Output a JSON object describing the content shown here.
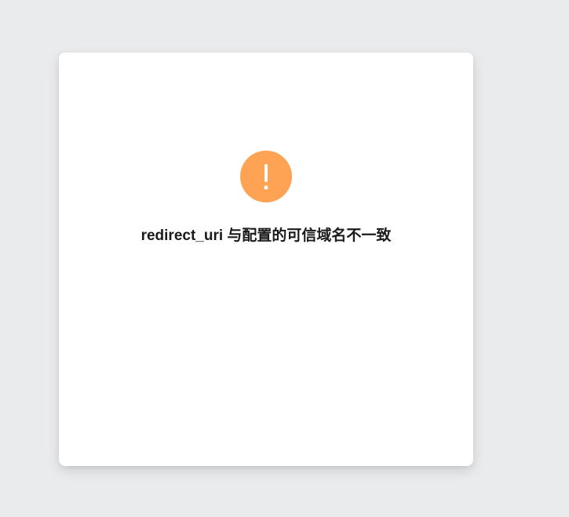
{
  "dialog": {
    "icon": "exclamation-circle-icon",
    "icon_color": "#fea354",
    "message": "redirect_uri 与配置的可信域名不一致"
  },
  "colors": {
    "page_background": "#eaebed",
    "card_background": "#ffffff",
    "text": "#1a1a1a"
  }
}
